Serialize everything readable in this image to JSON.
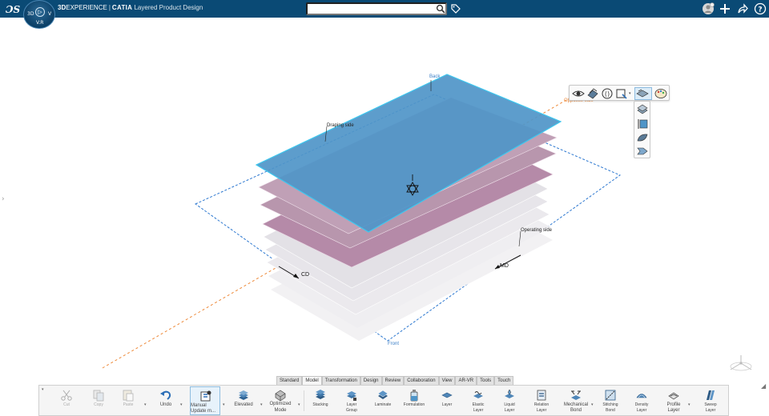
{
  "app": {
    "brand_bold": "3D",
    "brand_rest": "EXPERIENCE",
    "separator": "|",
    "app_name": "CATIA",
    "app_subtitle": "Layered Product Design",
    "logo_text": "3DS",
    "compass": {
      "left": "3D",
      "right": "V",
      "bottom": "V.R"
    }
  },
  "search": {
    "placeholder": "",
    "value": ""
  },
  "topbar_icons": [
    "user-avatar-icon",
    "add-icon",
    "share-icon",
    "help-icon"
  ],
  "scene": {
    "labels": {
      "back": "Back",
      "front": "Front",
      "draping_side": "Draping side",
      "operating_side": "Operating side",
      "opposite": "Opposite side",
      "cd": "CD",
      "md": "MD"
    },
    "colors": {
      "top_layer": "#4f95c8",
      "top_layer_edge": "#3ec7ee",
      "pink_layer": "#b58aa8",
      "gray_layer": "#e4e2e6",
      "dashed_frame": "#2d78d0",
      "orange_axis": "#ee8a3a"
    }
  },
  "floating_toolbar": {
    "row": [
      "eye-icon",
      "render-style-icon",
      "parenthesis-icon",
      "view-select-icon",
      "layer-display-icon",
      "palette-icon"
    ],
    "column": [
      "layer-stack-icon",
      "thickness-icon",
      "leaf-icon",
      "arrow-right-icon"
    ]
  },
  "tabs": [
    {
      "label": "Standard",
      "active": false
    },
    {
      "label": "Model",
      "active": true
    },
    {
      "label": "Transformation",
      "active": false
    },
    {
      "label": "Design",
      "active": false
    },
    {
      "label": "Review",
      "active": false
    },
    {
      "label": "Collaboration",
      "active": false
    },
    {
      "label": "View",
      "active": false
    },
    {
      "label": "AR-VR",
      "active": false
    },
    {
      "label": "Tools",
      "active": false
    },
    {
      "label": "Touch",
      "active": false
    }
  ],
  "actionbar": {
    "cut": "Cut",
    "copy": "Copy",
    "paste": "Paste",
    "undo": "Undo",
    "manual_update_1": "Manual",
    "manual_update_2": "Update m...",
    "elevated": "Elevated",
    "optimized_1": "Optimized",
    "optimized_2": "Mode",
    "stacking": "Stacking",
    "layer_group_1": "Layer",
    "layer_group_2": "Group",
    "laminate": "Laminate",
    "formulation": "Formulation",
    "layer": "Layer",
    "elastic_1": "Elastic",
    "elastic_2": "Layer",
    "liquid_1": "Liquid",
    "liquid_2": "Layer",
    "relation_1": "Relation",
    "relation_2": "Layer",
    "mechanical_1": "Mechanical",
    "mechanical_2": "Bond",
    "stitching_1": "Stitching",
    "stitching_2": "Bond",
    "density_1": "Density",
    "density_2": "Layer",
    "profile_1": "Profile",
    "profile_2": "Layer",
    "sweep_1": "Sweep",
    "sweep_2": "Layer"
  }
}
